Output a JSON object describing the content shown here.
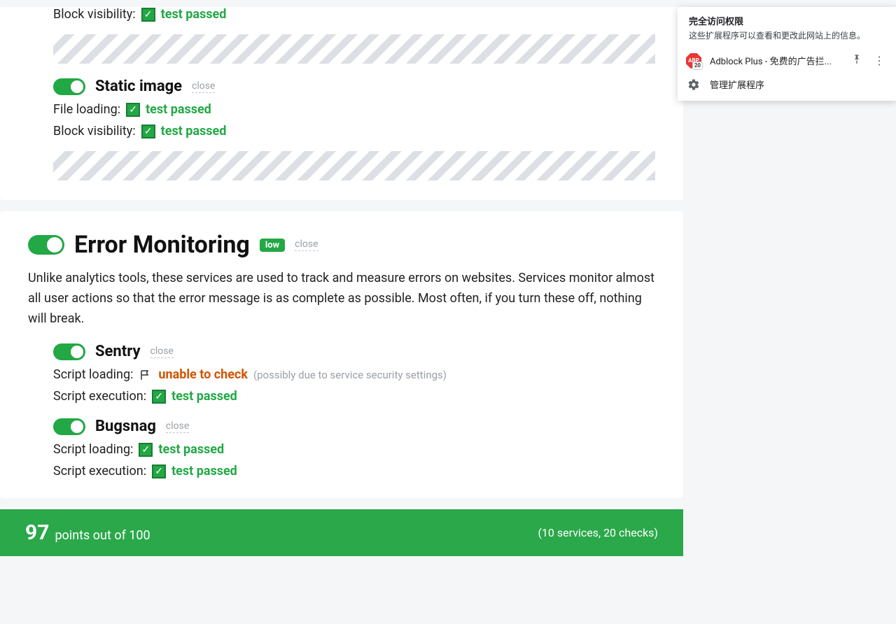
{
  "top_card": {
    "line1_label": "Block visibility:",
    "pass": "test passed",
    "static_image": {
      "title": "Static image",
      "close": "close",
      "line1_label": "File loading:",
      "line2_label": "Block visibility:"
    }
  },
  "error_monitoring": {
    "title": "Error Monitoring",
    "badge": "low",
    "close": "close",
    "desc": "Unlike analytics tools, these services are used to track and measure errors on websites. Services monitor almost all user actions so that the error message is as complete as possible. Most often, if you turn these off, nothing will break.",
    "sentry": {
      "title": "Sentry",
      "close": "close",
      "line1_label": "Script loading:",
      "line1_status": "unable to check",
      "line1_hint": "(possibly due to service security settings)",
      "line2_label": "Script execution:"
    },
    "bugsnag": {
      "title": "Bugsnag",
      "close": "close",
      "line1_label": "Script loading:",
      "line2_label": "Script execution:"
    }
  },
  "score": {
    "points": "97",
    "points_text": "points out of 100",
    "summary": "(10 services, 20 checks)"
  },
  "ext": {
    "title": "完全访问权限",
    "subtitle": "这些扩展程序可以查看和更改此网站上的信息。",
    "abp_name": "Adblock Plus - 免费的广告拦...",
    "abp_badge": "20",
    "manage": "管理扩展程序"
  },
  "labels": {
    "test_passed": "test passed"
  }
}
